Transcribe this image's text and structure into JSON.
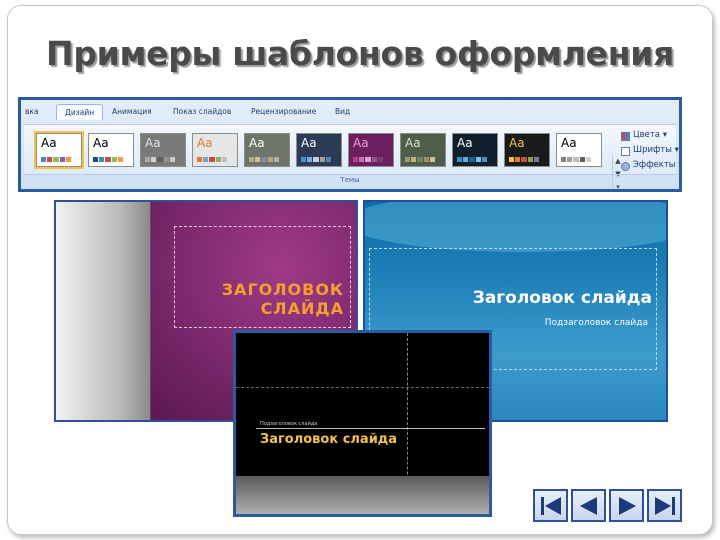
{
  "slide": {
    "title": "Примеры шаблонов оформления"
  },
  "ribbon": {
    "tabs": [
      "вка",
      "Дизайн",
      "Анимация",
      "Показ слайдов",
      "Рецензирование",
      "Вид"
    ],
    "active_tab": "Дизайн",
    "themes": [
      {
        "label": "Aa",
        "bg": "#ffffff",
        "fg": "#000000",
        "swatch": [
          "#4f81bd",
          "#c0504d",
          "#9bbb59",
          "#8064a2",
          "#f79646"
        ]
      },
      {
        "label": "Aa",
        "bg": "#ffffff",
        "fg": "#000000",
        "swatch": [
          "#1f497d",
          "#4f81bd",
          "#c0504d",
          "#9bbb59",
          "#f79646"
        ]
      },
      {
        "label": "Aa",
        "bg": "#7a7a7a",
        "fg": "#e0e0e0",
        "swatch": [
          "#aaaaaa",
          "#d0d0d0",
          "#606060",
          "#909090",
          "#c8c8c8"
        ]
      },
      {
        "label": "Aa",
        "bg": "#e6e6e6",
        "fg": "#e87a2a",
        "swatch": [
          "#e87a2a",
          "#7a9fd0",
          "#c05050",
          "#90b060",
          "#c0c0c0"
        ]
      },
      {
        "label": "Aa",
        "bg": "#6f7468",
        "fg": "#ffffff",
        "swatch": [
          "#a8b090",
          "#d8c090",
          "#8090a0",
          "#c0a080",
          "#b0b0b0"
        ]
      },
      {
        "label": "Aa",
        "bg": "#2b3a55",
        "fg": "#ffffff",
        "swatch": [
          "#4a90d0",
          "#70b0e0",
          "#d0d0d0",
          "#a0a0a0",
          "#6080a0"
        ]
      },
      {
        "label": "Aa",
        "bg": "#6a1f60",
        "fg": "#f09ad0",
        "swatch": [
          "#b04090",
          "#d070b0",
          "#e0a0d0",
          "#a05090",
          "#704070"
        ]
      },
      {
        "label": "Aa",
        "bg": "#4f5e48",
        "fg": "#e0e0c0",
        "swatch": [
          "#90a070",
          "#c0b080",
          "#708060",
          "#a09060",
          "#d0c0a0"
        ]
      },
      {
        "label": "Aa",
        "bg": "#0f1f2e",
        "fg": "#ffffff",
        "swatch": [
          "#3090d0",
          "#60b0e0",
          "#2060a0",
          "#80c0e0",
          "#5090c0"
        ]
      },
      {
        "label": "Aa",
        "bg": "#1a1a1a",
        "fg": "#f2c24a",
        "swatch": [
          "#f2c24a",
          "#e07a2a",
          "#c05040",
          "#90a050",
          "#708090"
        ]
      },
      {
        "label": "Aa",
        "bg": "#ffffff",
        "fg": "#000000",
        "swatch": [
          "#808080",
          "#a0a0a0",
          "#c0c0c0",
          "#606060",
          "#d0d0d0"
        ]
      }
    ],
    "commands": [
      "Цвета",
      "Шрифты",
      "Эффекты"
    ],
    "group_label": "Темы",
    "scroll": [
      "▲",
      "▼",
      "▾"
    ]
  },
  "previews": {
    "purple": {
      "title": "ЗАГОЛОВОК\nСЛАЙДА"
    },
    "blue": {
      "title": "Заголовок слайда",
      "subtitle": "Подзаголовок слайда"
    },
    "dark": {
      "title": "Заголовок слайда",
      "subtitle": "Подзаголовок слайда"
    }
  },
  "nav": [
    "first",
    "previous",
    "next",
    "last"
  ]
}
